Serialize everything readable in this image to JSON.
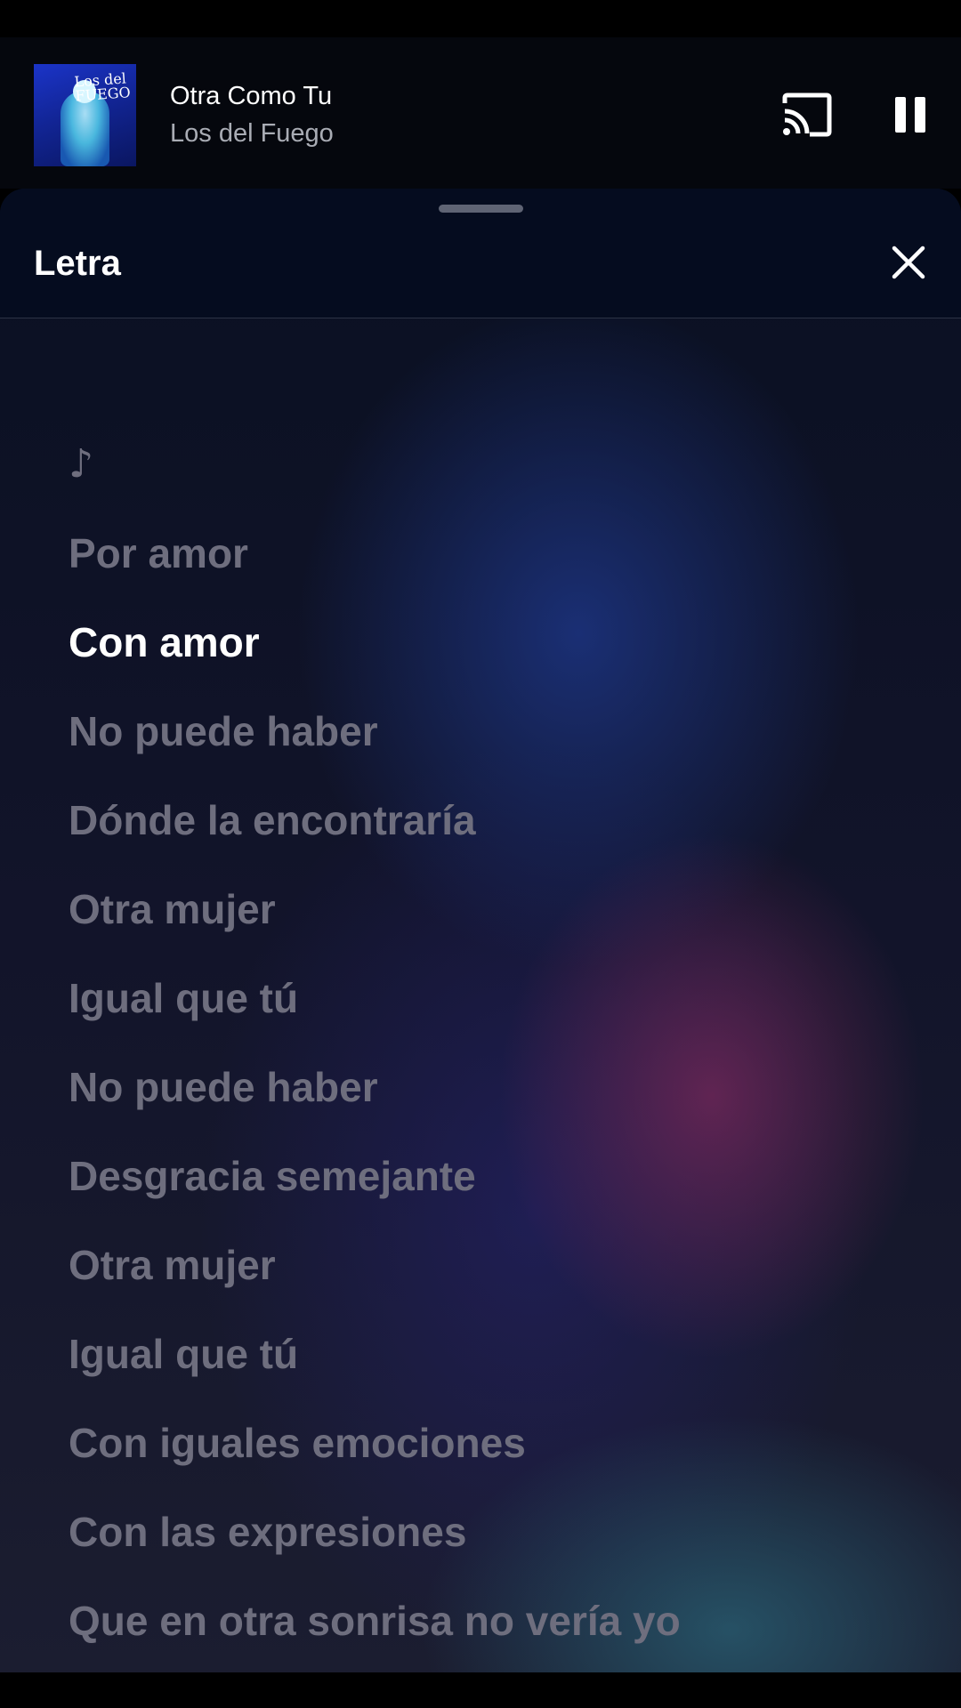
{
  "mini_player": {
    "song_title": "Otra Como Tu",
    "artist": "Los del Fuego",
    "album_art_text": "Los del FUEGO",
    "cast_icon": "cast-icon",
    "pause_icon": "pause-icon"
  },
  "lyrics_sheet": {
    "title": "Letra",
    "close_icon": "close-icon",
    "note_symbol": "♪",
    "active_index": 1,
    "lines": [
      "Por amor",
      "Con amor",
      "No puede haber",
      "Dónde la encontraría",
      "Otra mujer",
      "Igual que tú",
      "No puede haber",
      "Desgracia semejante",
      "Otra mujer",
      "Igual que tú",
      "Con iguales emociones",
      "Con las expresiones",
      "Que en otra sonrisa no vería yo"
    ]
  },
  "colors": {
    "active_lyric": "#ffffff",
    "inactive_lyric": "#6e6e7e",
    "header_bg": "#050c1f"
  }
}
